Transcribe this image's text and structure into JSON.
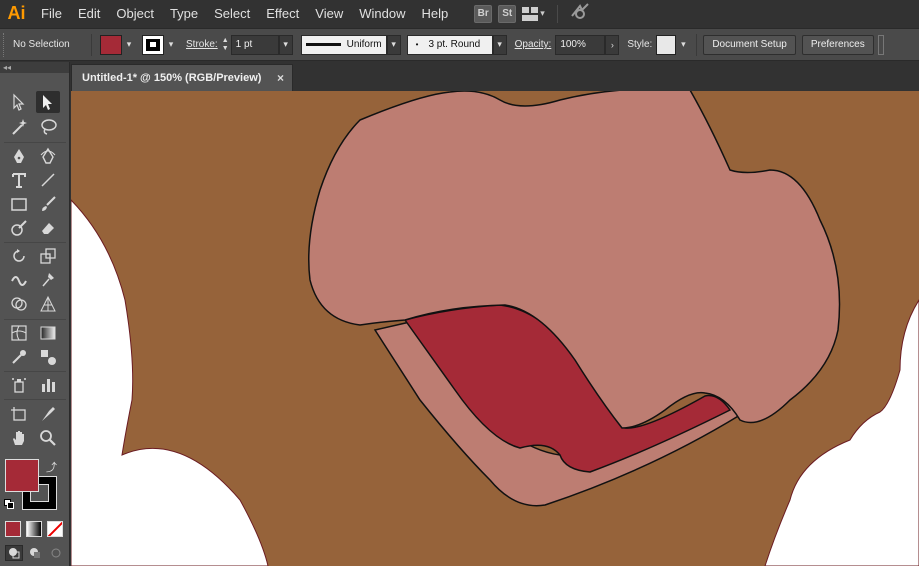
{
  "app": {
    "logo": "Ai"
  },
  "menu": [
    "File",
    "Edit",
    "Object",
    "Type",
    "Select",
    "Effect",
    "View",
    "Window",
    "Help"
  ],
  "bridge": {
    "br": "Br",
    "st": "St"
  },
  "control": {
    "selection": "No Selection",
    "stroke_label": "Stroke:",
    "stroke_weight": "1 pt",
    "stroke_profile": "Uniform",
    "brush": "3 pt. Round",
    "opacity_label": "Opacity:",
    "opacity_value": "100%",
    "style_label": "Style:",
    "doc_setup": "Document Setup",
    "preferences": "Preferences"
  },
  "document": {
    "tab_title": "Untitled-1* @ 150% (RGB/Preview)",
    "close": "×"
  },
  "toolbar": {
    "collapse": "◂◂"
  },
  "colors": {
    "accent": "#ff9a00",
    "fill": "#a52a37",
    "background_skin": "#96633a",
    "nose": "#bd7d72",
    "tongue": "#a52a37",
    "white": "#ffffff"
  }
}
